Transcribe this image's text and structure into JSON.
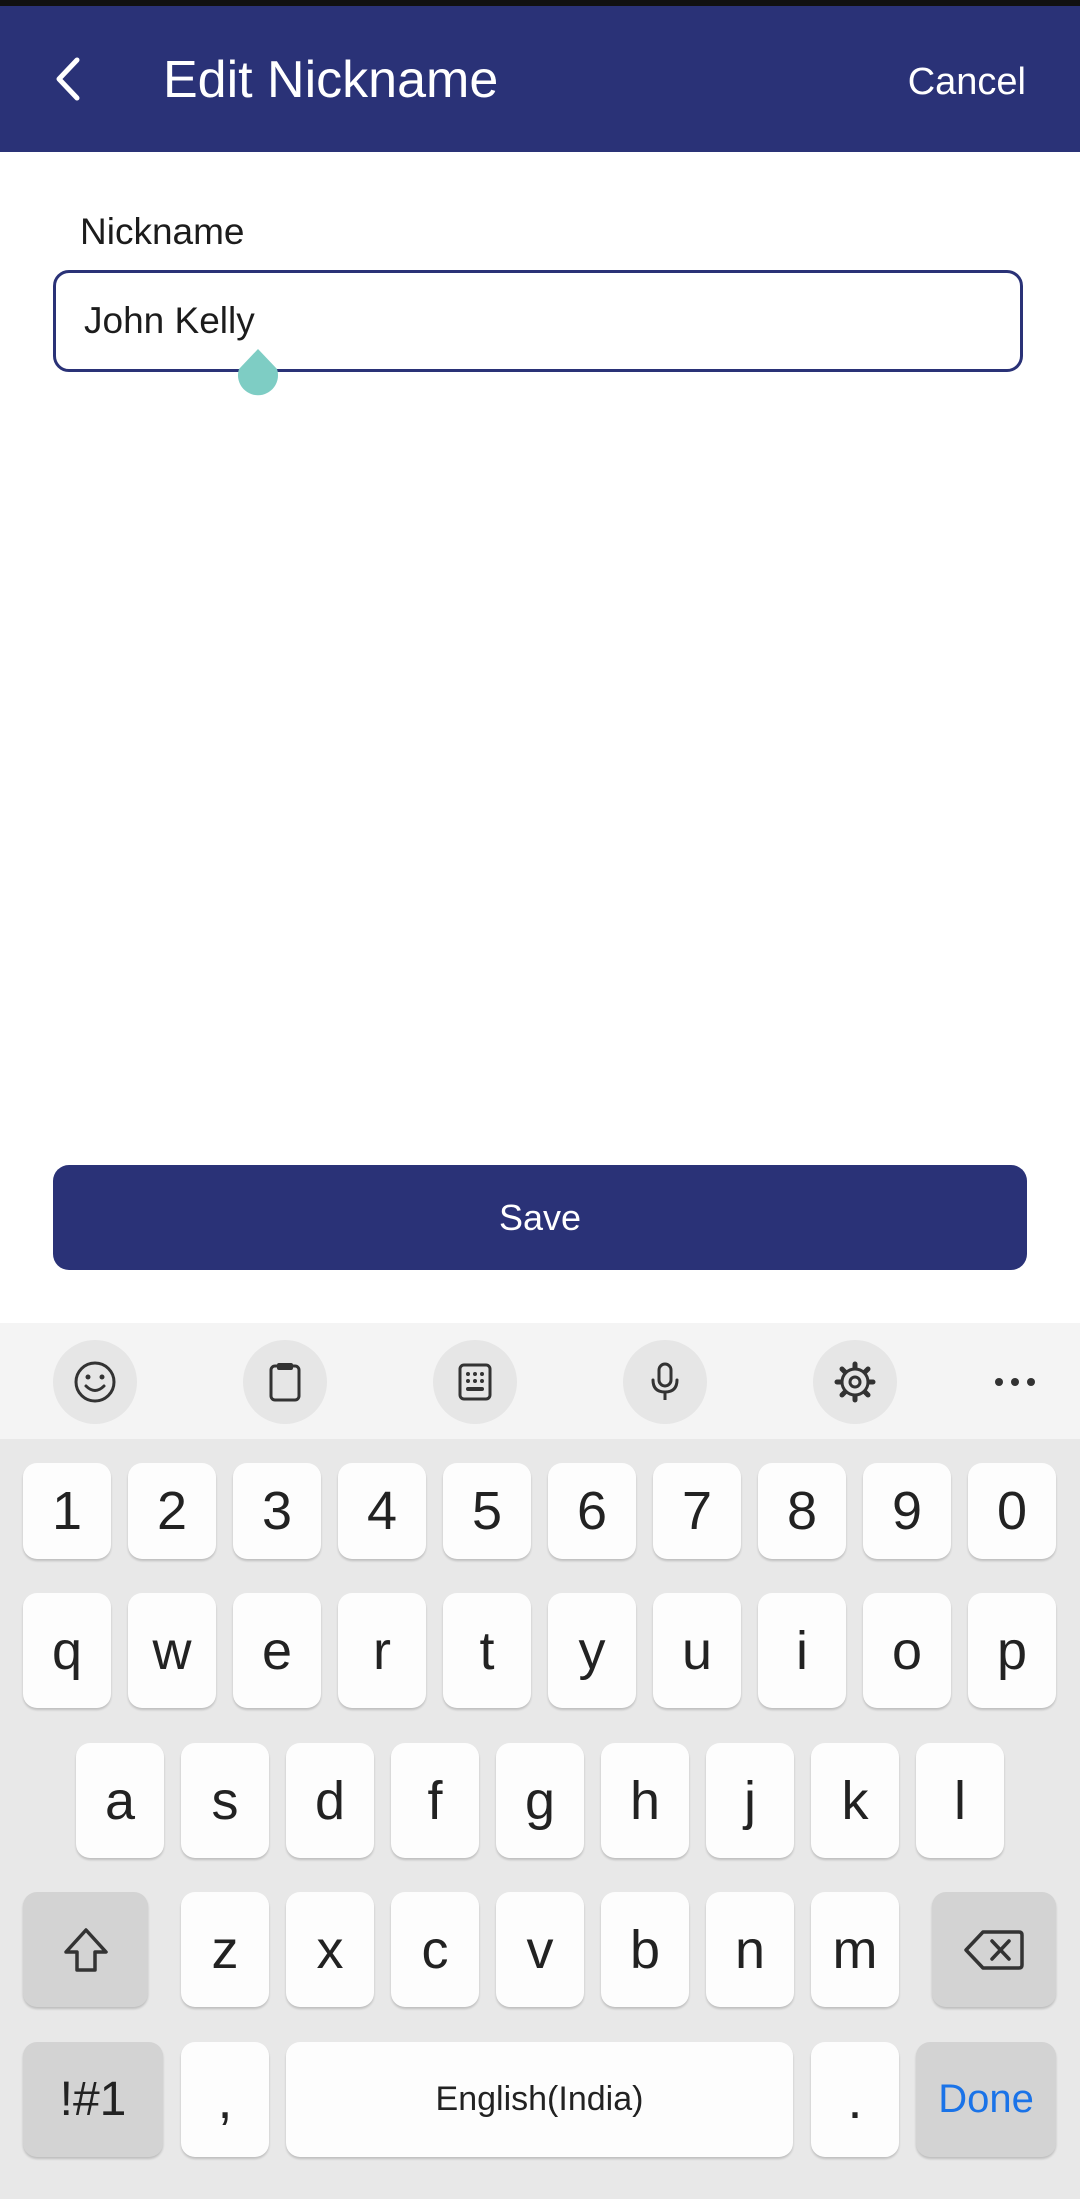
{
  "app_bar": {
    "title": "Edit Nickname",
    "cancel_label": "Cancel"
  },
  "form": {
    "label": "Nickname",
    "value": "John Kelly"
  },
  "save_label": "Save",
  "colors": {
    "primary": "#2a3277",
    "cursor_handle": "#7ecdc4",
    "done_key": "#1a73e8"
  },
  "keyboard": {
    "toolbar": [
      "emoji-icon",
      "clipboard-icon",
      "keypad-icon",
      "microphone-icon",
      "settings-icon",
      "more-icon"
    ],
    "row_numbers": [
      "1",
      "2",
      "3",
      "4",
      "5",
      "6",
      "7",
      "8",
      "9",
      "0"
    ],
    "row_top": [
      "q",
      "w",
      "e",
      "r",
      "t",
      "y",
      "u",
      "i",
      "o",
      "p"
    ],
    "row_middle": [
      "a",
      "s",
      "d",
      "f",
      "g",
      "h",
      "j",
      "k",
      "l"
    ],
    "row_bottom": [
      "z",
      "x",
      "c",
      "v",
      "b",
      "n",
      "m"
    ],
    "symbols_label": "!#1",
    "comma_label": ",",
    "space_label": "English(India)",
    "period_label": ".",
    "done_label": "Done"
  }
}
